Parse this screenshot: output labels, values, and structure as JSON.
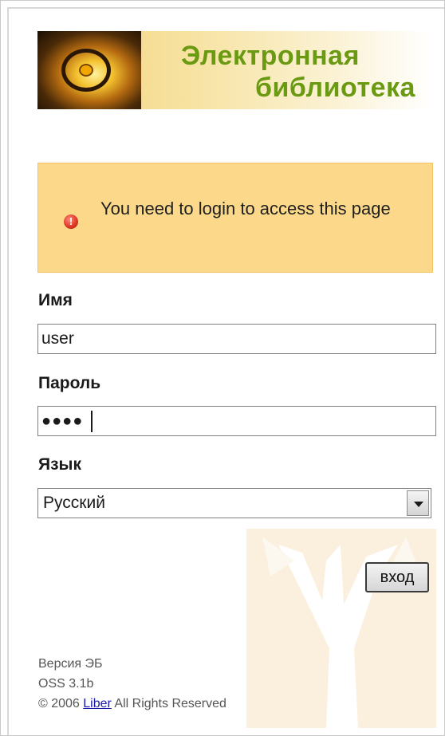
{
  "banner": {
    "title_line1": "Электронная",
    "title_line2": "библиотека",
    "title_color": "#6a9a12"
  },
  "alert": {
    "icon": "error-icon",
    "icon_glyph": "!",
    "message": "You need to login to access this page",
    "background": "#fcd98a"
  },
  "form": {
    "username_label": "Имя",
    "username_value": "user",
    "password_label": "Пароль",
    "password_mask": "●●●●",
    "language_label": "Язык",
    "language_selected": "Русский",
    "submit_label": "вход"
  },
  "footer": {
    "version_line": "Версия ЭБ",
    "release_line": "OSS 3.1b",
    "copyright_prefix": "© 2006 ",
    "copyright_link": "Liber",
    "copyright_suffix": " All Rights Reserved"
  }
}
